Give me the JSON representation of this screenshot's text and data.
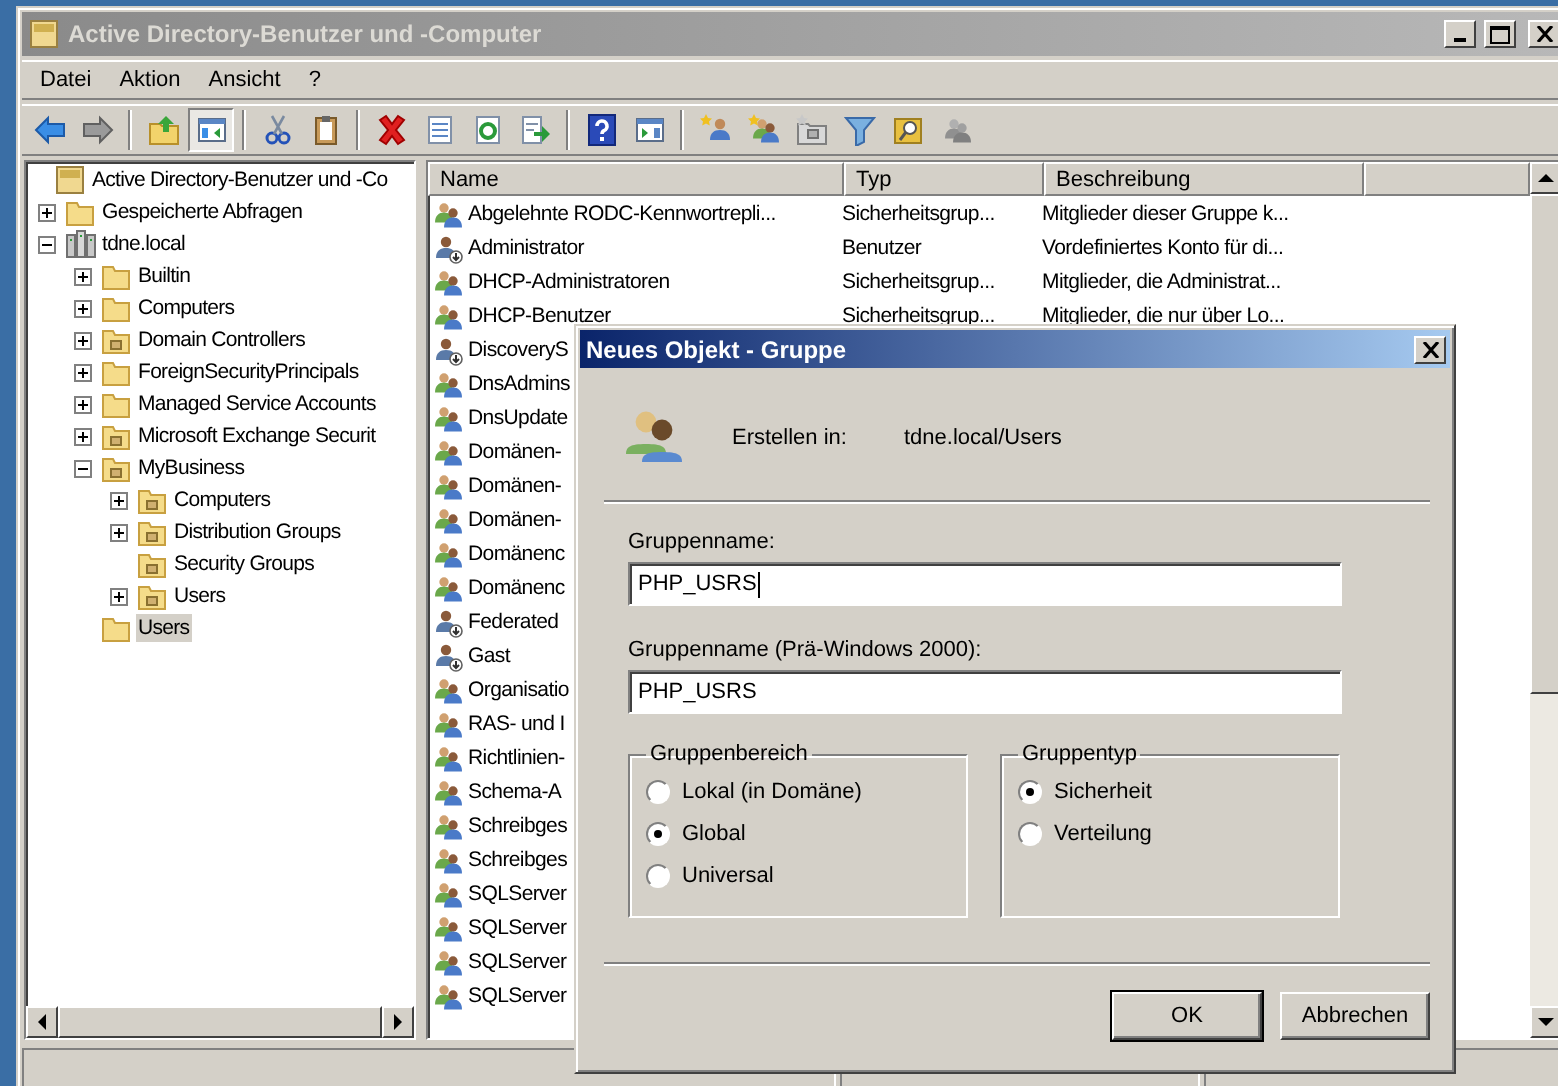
{
  "window": {
    "title": "Active Directory-Benutzer und -Computer"
  },
  "menu": [
    "Datei",
    "Aktion",
    "Ansicht",
    "?"
  ],
  "toolbar_groups": [
    {
      "buttons": [
        {
          "kind": "back",
          "pressed": false
        },
        {
          "kind": "forward",
          "pressed": false
        }
      ]
    },
    {
      "buttons": [
        {
          "kind": "up",
          "pressed": false
        },
        {
          "kind": "console_tree",
          "pressed": true
        }
      ]
    },
    {
      "buttons": [
        {
          "kind": "cut",
          "pressed": false
        },
        {
          "kind": "paste",
          "pressed": false
        }
      ]
    },
    {
      "buttons": [
        {
          "kind": "delete",
          "pressed": false
        },
        {
          "kind": "properties",
          "pressed": false
        },
        {
          "kind": "refresh",
          "pressed": false
        },
        {
          "kind": "export",
          "pressed": false
        }
      ]
    },
    {
      "buttons": [
        {
          "kind": "help",
          "pressed": false
        },
        {
          "kind": "action_pane",
          "pressed": false
        }
      ]
    },
    {
      "buttons": [
        {
          "kind": "new_user",
          "pressed": false
        },
        {
          "kind": "new_group",
          "pressed": false
        },
        {
          "kind": "new_ou",
          "pressed": false
        },
        {
          "kind": "filter",
          "pressed": false
        },
        {
          "kind": "find",
          "pressed": false
        },
        {
          "kind": "add_to_group",
          "pressed": false
        }
      ]
    }
  ],
  "tree": {
    "root": {
      "label": "Active Directory-Benutzer und -Co",
      "selected": false
    },
    "items": [
      {
        "label": "Gespeicherte Abfragen",
        "kind": "folder",
        "expandable": true,
        "expanded": false,
        "selected": false
      },
      {
        "label": "tdne.local",
        "kind": "domain",
        "expandable": true,
        "expanded": true,
        "selected": false,
        "children": [
          {
            "label": "Builtin",
            "kind": "folder",
            "expandable": true,
            "expanded": false,
            "selected": false
          },
          {
            "label": "Computers",
            "kind": "folder",
            "expandable": true,
            "expanded": false,
            "selected": false
          },
          {
            "label": "Domain Controllers",
            "kind": "ou",
            "expandable": true,
            "expanded": false,
            "selected": false
          },
          {
            "label": "ForeignSecurityPrincipals",
            "kind": "folder",
            "expandable": true,
            "expanded": false,
            "selected": false
          },
          {
            "label": "Managed Service Accounts",
            "kind": "folder",
            "expandable": true,
            "expanded": false,
            "selected": false
          },
          {
            "label": "Microsoft Exchange Securit",
            "kind": "ou",
            "expandable": true,
            "expanded": false,
            "selected": false
          },
          {
            "label": "MyBusiness",
            "kind": "ou",
            "expandable": true,
            "expanded": true,
            "selected": false,
            "children": [
              {
                "label": "Computers",
                "kind": "ou",
                "expandable": true,
                "expanded": false,
                "selected": false
              },
              {
                "label": "Distribution Groups",
                "kind": "ou",
                "expandable": true,
                "expanded": false,
                "selected": false
              },
              {
                "label": "Security Groups",
                "kind": "ou",
                "expandable": false,
                "selected": false
              },
              {
                "label": "Users",
                "kind": "ou",
                "expandable": true,
                "expanded": false,
                "selected": false
              }
            ]
          },
          {
            "label": "Users",
            "kind": "folder",
            "expandable": false,
            "selected": true
          }
        ]
      }
    ]
  },
  "list": {
    "columns": [
      "Name",
      "Typ",
      "Beschreibung"
    ],
    "rows": [
      {
        "kind": "group",
        "name": "Abgelehnte RODC-Kennwortrepli...",
        "type": "Sicherheitsgrup...",
        "description": "Mitglieder dieser Gruppe k..."
      },
      {
        "kind": "user",
        "name": "Administrator",
        "type": "Benutzer",
        "description": "Vordefiniertes Konto für di..."
      },
      {
        "kind": "group",
        "name": "DHCP-Administratoren",
        "type": "Sicherheitsgrup...",
        "description": "Mitglieder, die Administrat..."
      },
      {
        "kind": "group",
        "name": "DHCP-Benutzer",
        "type": "Sicherheitsgrup...",
        "description": "Mitglieder, die nur über Lo..."
      },
      {
        "kind": "user",
        "name": "DiscoveryS"
      },
      {
        "kind": "group",
        "name": "DnsAdmins"
      },
      {
        "kind": "group",
        "name": "DnsUpdate"
      },
      {
        "kind": "group",
        "name": "Domänen-"
      },
      {
        "kind": "group",
        "name": "Domänen-"
      },
      {
        "kind": "group",
        "name": "Domänen-"
      },
      {
        "kind": "group",
        "name": "Domänenc"
      },
      {
        "kind": "group",
        "name": "Domänenc"
      },
      {
        "kind": "user",
        "name": "Federated"
      },
      {
        "kind": "user",
        "name": "Gast"
      },
      {
        "kind": "group",
        "name": "Organisatio"
      },
      {
        "kind": "group",
        "name": "RAS- und I"
      },
      {
        "kind": "group",
        "name": "Richtlinien-"
      },
      {
        "kind": "group",
        "name": "Schema-A"
      },
      {
        "kind": "group",
        "name": "Schreibges"
      },
      {
        "kind": "group",
        "name": "Schreibges"
      },
      {
        "kind": "group",
        "name": "SQLServer"
      },
      {
        "kind": "group",
        "name": "SQLServer"
      },
      {
        "kind": "group",
        "name": "SQLServer"
      },
      {
        "kind": "group",
        "name": "SQLServer"
      }
    ]
  },
  "dialog": {
    "title": "Neues Objekt - Gruppe",
    "create_in_label": "Erstellen in:",
    "create_in_path": "tdne.local/Users",
    "fields": [
      {
        "label": "Gruppenname:",
        "value": "PHP_USRS",
        "focused": true
      },
      {
        "label": "Gruppenname (Prä-Windows 2000):",
        "value": "PHP_USRS",
        "focused": false
      }
    ],
    "groups": [
      {
        "title": "Gruppenbereich",
        "options": [
          {
            "label": "Lokal (in Domäne)",
            "selected": false
          },
          {
            "label": "Global",
            "selected": true
          },
          {
            "label": "Universal",
            "selected": false
          }
        ]
      },
      {
        "title": "Gruppentyp",
        "options": [
          {
            "label": "Sicherheit",
            "selected": true
          },
          {
            "label": "Verteilung",
            "selected": false
          }
        ]
      }
    ],
    "buttons": [
      {
        "label": "OK",
        "default": true
      },
      {
        "label": "Abbrechen",
        "default": false
      }
    ]
  }
}
